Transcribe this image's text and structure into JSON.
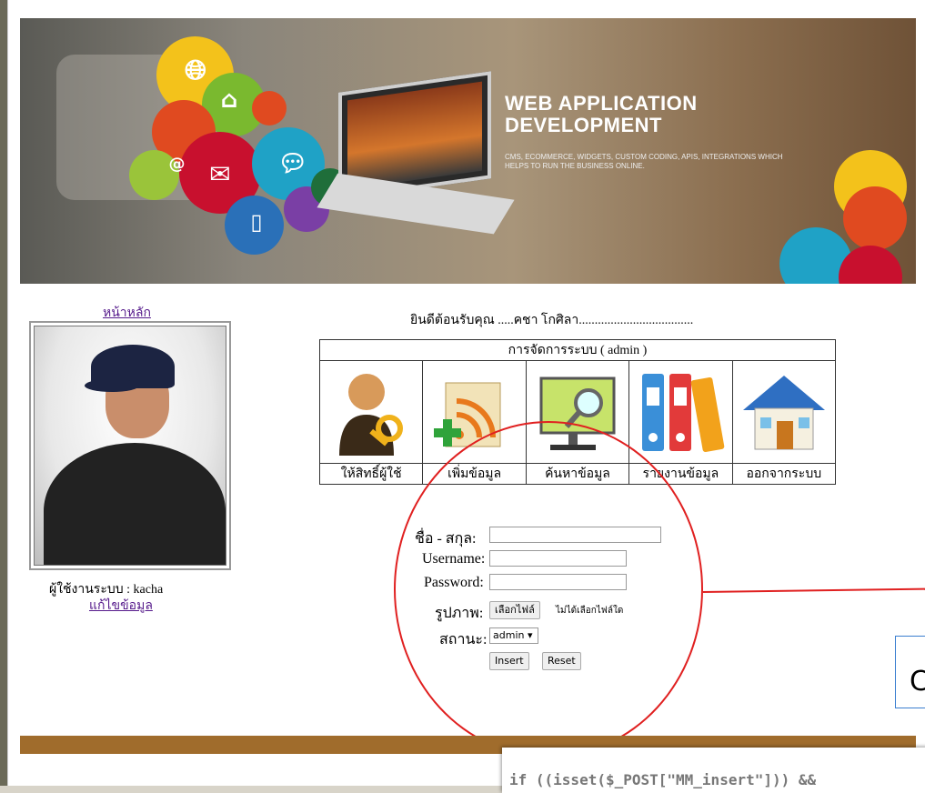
{
  "banner": {
    "title_line1": "WEB APPLICATION",
    "title_line2": "DEVELOPMENT",
    "subtitle": "CMS, ECOMMERCE, WIDGETS, CUSTOM CODING, APIS, INTEGRATIONS WHICH HELPS TO RUN THE BUSINESS ONLINE."
  },
  "sidebar": {
    "home_link": "หน้าหลัก",
    "user_label": "ผู้ใช้งานระบบ : kacha",
    "edit_link": "แก้ไขข้อมูล"
  },
  "welcome": "ยินดีต้อนรับคุณ .....คชา โกศิลา....................................",
  "admin_menu": {
    "header": "การจัดการระบบ ( admin )",
    "items": [
      {
        "label": "ให้สิทธิ์ผู้ใช้",
        "icon": "user-key-icon"
      },
      {
        "label": "เพิ่มข้อมูล",
        "icon": "add-rss-icon"
      },
      {
        "label": "ค้นหาข้อมูล",
        "icon": "search-monitor-icon"
      },
      {
        "label": "รายงานข้อมูล",
        "icon": "binders-icon"
      },
      {
        "label": "ออกจากระบบ",
        "icon": "house-icon"
      }
    ]
  },
  "form": {
    "fullname_label": "ชื่อ - สกุล:",
    "username_label": "Username:",
    "password_label": "Password:",
    "image_label": "รูปภาพ:",
    "choose_file_button": "เลือกไฟล์",
    "no_file_text": "ไม่ได้เลือกไฟล์ใด",
    "status_label": "สถานะ:",
    "status_value": "admin",
    "insert_button": "Insert",
    "reset_button": "Reset"
  },
  "callout_text": "C",
  "code_snippet": "if ((isset($_POST[\"MM_insert\"])) &&",
  "colors": {
    "annotation_red": "#e02020",
    "footer_brown": "#a06c2c",
    "link_purple": "#551a8b"
  }
}
